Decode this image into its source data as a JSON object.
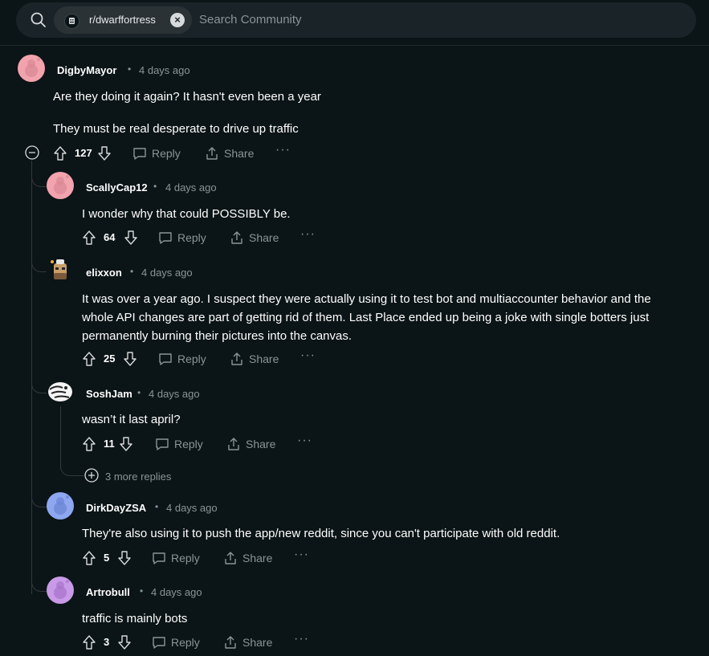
{
  "search": {
    "community": "r/dwarffortress",
    "placeholder": "Search Community"
  },
  "actions": {
    "reply": "Reply",
    "share": "Share",
    "more": "···"
  },
  "comments": [
    {
      "user": "DigbyMayor",
      "time": "4 days ago",
      "votes": "127",
      "paragraphs": [
        "Are they doing it again? It hasn't even been a year",
        "They must be real desperate to drive up traffic"
      ]
    },
    {
      "user": "ScallyCap12",
      "time": "4 days ago",
      "votes": "64",
      "text": "I wonder why that could POSSIBLY be."
    },
    {
      "user": "elixxon",
      "time": "4 days ago",
      "votes": "25",
      "lines": [
        "It was over a year ago. I suspect they were actually using it to test bot and multiaccounter behavior and the",
        "whole API changes are part of getting rid of them. Last Place ended up being a joke with single botters just",
        "permanently burning their pictures into the canvas."
      ]
    },
    {
      "user": "SoshJam",
      "time": "4 days ago",
      "votes": "11",
      "text": "wasn’t it last april?",
      "more_replies": "3 more replies"
    },
    {
      "user": "DirkDayZSA",
      "time": "4 days ago",
      "votes": "5",
      "text": "They're also using it to push the app/new reddit, since you can't participate with old reddit."
    },
    {
      "user": "Artrobull",
      "time": "4 days ago",
      "votes": "3",
      "text": "traffic is mainly bots"
    }
  ],
  "colors": {
    "background": "#0b1416",
    "avatar_pink": "#f2a3ad",
    "avatar_blue": "#8ea7f0",
    "avatar_purple": "#c99ae8"
  }
}
